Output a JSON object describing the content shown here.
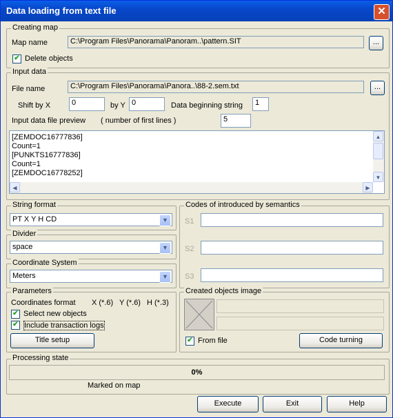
{
  "window": {
    "title": "Data loading from text file",
    "close_glyph": "✕"
  },
  "creating_map": {
    "legend": "Creating map",
    "map_name_label": "Map name",
    "map_name_value": "C:\\Program Files\\Panorama\\Panoram..\\pattern.SIT",
    "browse_label": "...",
    "delete_objects_label": "Delete objects",
    "delete_objects_checked": true
  },
  "input_data": {
    "legend": "Input data",
    "file_name_label": "File name",
    "file_name_value": "C:\\Program Files\\Panorama\\Panora..\\88-2.sem.txt",
    "browse_label": "...",
    "shift_x_label": "Shift by X",
    "shift_x_value": "0",
    "shift_y_label": "by Y",
    "shift_y_value": "0",
    "data_beginning_label": "Data beginning string",
    "data_beginning_value": "1",
    "preview_label": "Input data file preview",
    "first_lines_label": "( number of first lines )",
    "first_lines_value": "5",
    "preview_lines": [
      "[ZEMDOC16777836]",
      "Count=1",
      "[PUNKTS16777836]",
      "Count=1",
      "[ZEMDOC16778252]"
    ]
  },
  "string_format": {
    "legend": "String format",
    "value": "PT  X  Y  H CD"
  },
  "divider": {
    "legend": "Divider",
    "value": "space"
  },
  "coordinate_system": {
    "legend": "Coordinate System",
    "value": "Meters"
  },
  "semantics": {
    "legend": "Codes of introduced by semantics",
    "s1_label": "S1",
    "s1_value": "",
    "s2_label": "S2",
    "s2_value": "",
    "s3_label": "S3",
    "s3_value": ""
  },
  "parameters": {
    "legend": "Parameters",
    "coordinates_format_label": "Coordinates format",
    "x_format": "X (*.6)",
    "y_format": "Y (*.6)",
    "h_format": "H (*.3)",
    "select_new_objects_label": "Select new objects",
    "select_new_objects_checked": true,
    "include_logs_label": "Include transaction logs",
    "include_logs_checked": true,
    "title_setup_label": "Title setup"
  },
  "created_objects": {
    "legend": "Created objects image",
    "from_file_label": "From file",
    "from_file_checked": true,
    "code_turning_label": "Code turning"
  },
  "processing": {
    "legend": "Processing state",
    "progress_text": "0%",
    "progress_fraction": 0,
    "status_text": "Marked on map"
  },
  "footer": {
    "execute_label": "Execute",
    "exit_label": "Exit",
    "help_label": "Help"
  },
  "glyphs": {
    "check": "✔",
    "down_arrow": "▼",
    "up_arrow": "▲",
    "left_arrow": "◀",
    "right_arrow": "▶"
  }
}
